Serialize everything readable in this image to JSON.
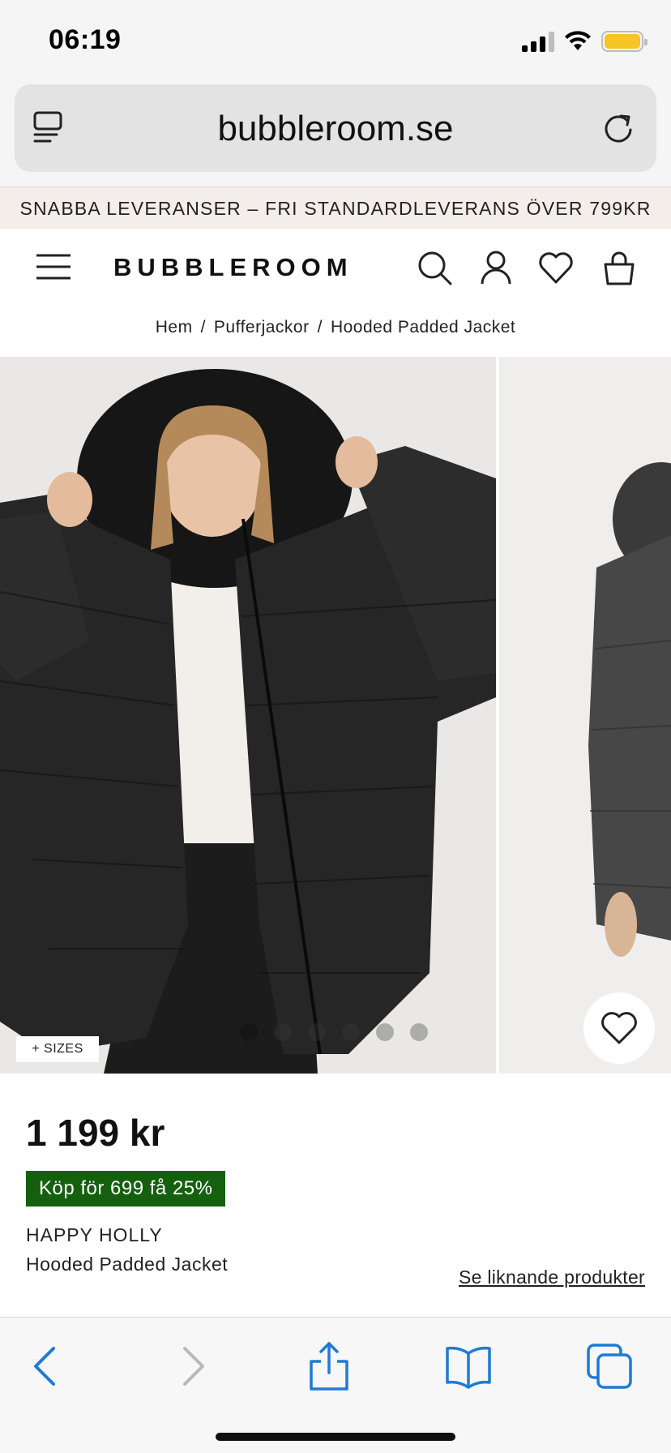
{
  "status_bar": {
    "time": "06:19",
    "icons": [
      "cellular-signal-icon",
      "wifi-icon",
      "battery-icon"
    ],
    "battery_color": "#f4c525"
  },
  "browser": {
    "url": "bubbleroom.se",
    "icons": [
      "reader-mode-icon",
      "reload-icon"
    ],
    "toolbar_icons": [
      "back-icon",
      "forward-icon",
      "share-icon",
      "bookmarks-icon",
      "tabs-icon"
    ],
    "accent_color": "#1f7ad6"
  },
  "site": {
    "promo_text": "SNABBA LEVERANSER – FRI STANDARDLEVERANS ÖVER 799KR",
    "logo": "BUBBLEROOM",
    "header_icons": [
      "menu-icon",
      "search-icon",
      "account-icon",
      "wishlist-icon",
      "cart-icon"
    ]
  },
  "breadcrumb": {
    "items": [
      "Hem",
      "Pufferjackor",
      "Hooded Padded Jacket"
    ],
    "separator": "/"
  },
  "gallery": {
    "sizes_label": "+ SIZES",
    "image_count": 6,
    "active_index": 0,
    "image_description_icons": [
      "product-photo-main",
      "product-photo-secondary"
    ]
  },
  "product": {
    "price": "1 199 kr",
    "promo_badge": "Köp för 699 få 25%",
    "promo_color": "#14600e",
    "brand": "HAPPY HOLLY",
    "name": "Hooded Padded Jacket",
    "similar_link": "Se liknande produkter"
  }
}
